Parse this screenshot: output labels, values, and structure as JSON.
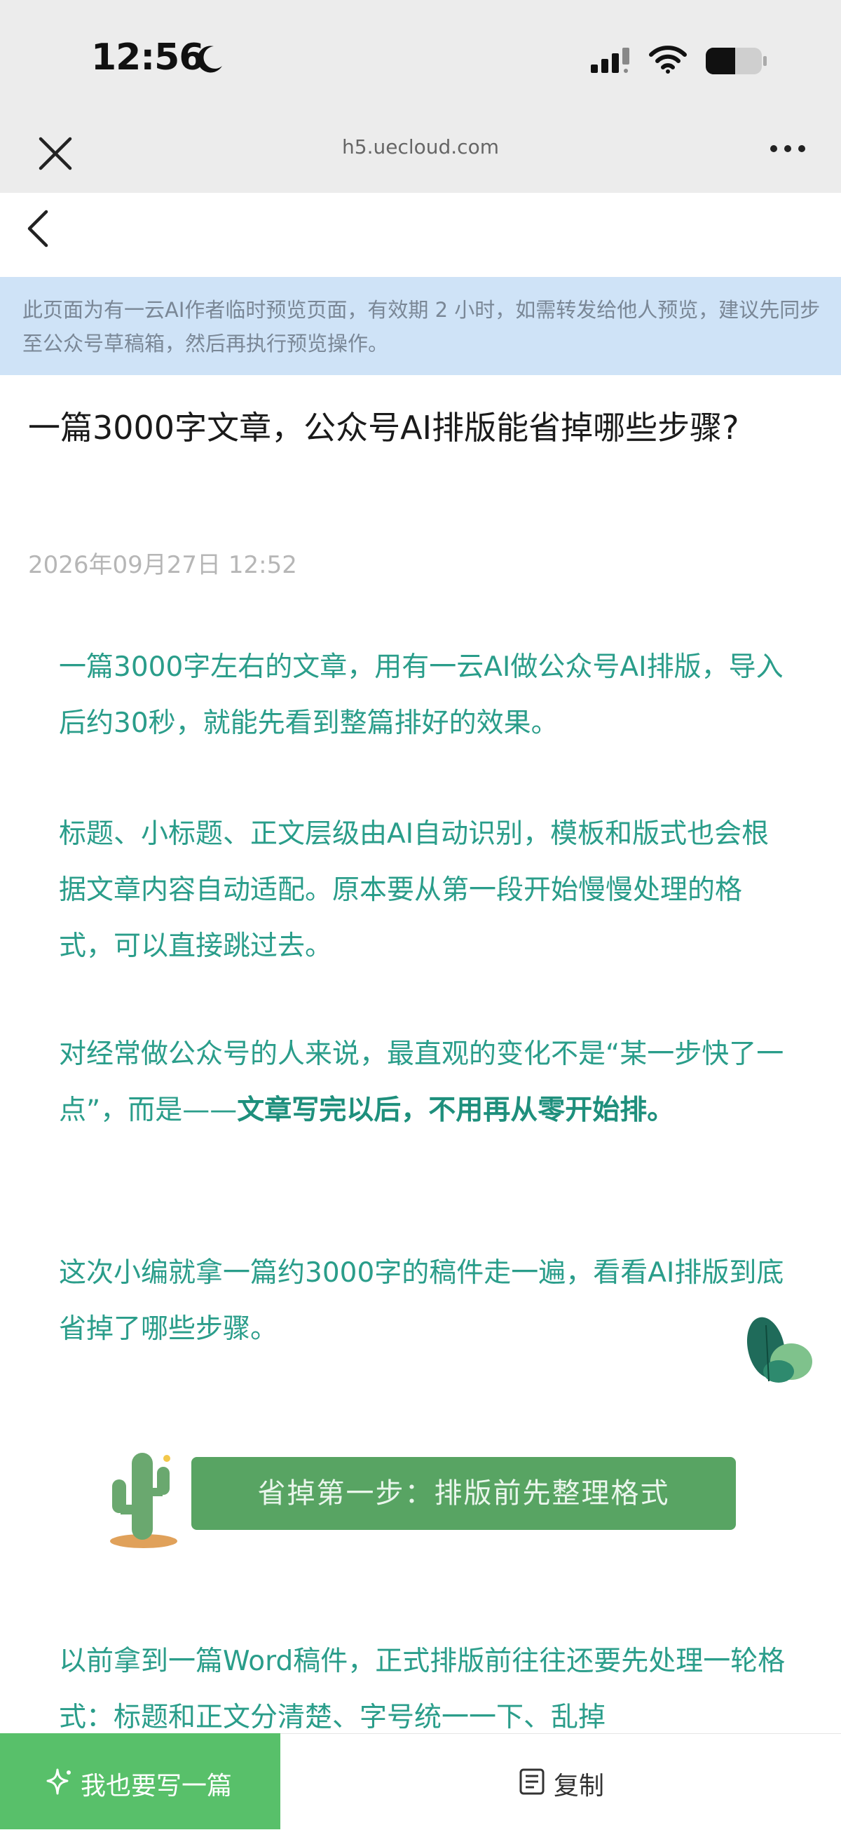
{
  "status_bar": {
    "time": "12:56"
  },
  "browser": {
    "url": "h5.uecloud.com"
  },
  "notice": "此页面为有一云AI作者临时预览页面，有效期 2 小时，如需转发给他人预览，建议先同步至公众号草稿箱，然后再执行预览操作。",
  "article": {
    "title": "一篇3000字文章，公众号AI排版能省掉哪些步骤?",
    "date": "2026年09月27日 12:52",
    "paragraphs": [
      "一篇3000字左右的文章，用有一云AI做公众号AI排版，导入后约30秒，就能先看到整篇排好的效果。",
      "标题、小标题、正文层级由AI自动识别，模板和版式也会根据文章内容自动适配。原本要从第一段开始慢慢处理的格式，可以直接跳过去。",
      "这次小编就拿一篇约3000字的稿件走一遍，看看AI排版到底省掉了哪些步骤。",
      "以前拿到一篇Word稿件，正式排版前往往还要先处理一轮格式：标题和正文分清楚、字号统一一下、乱掉"
    ],
    "para3_part1": "对经常做公众号的人来说，最直观的变化不是“某一步快了一点”，而是——",
    "para3_bold": "文章写完以后，不用再从零开始排。",
    "section1_title": "省掉第一步：排版前先整理格式"
  },
  "bottom_bar": {
    "write_label": "我也要写一篇",
    "copy_label": "复制"
  },
  "colors": {
    "accent_green": "#58a463",
    "write_button": "#58c06a",
    "body_text": "#2a9d8a",
    "notice_bg": "#cfe3f7"
  },
  "icons": [
    "moon-icon",
    "signal-icon",
    "wifi-icon",
    "battery-icon",
    "close-icon",
    "more-icon",
    "back-chevron-icon",
    "sparkle-icon",
    "copy-icon"
  ]
}
